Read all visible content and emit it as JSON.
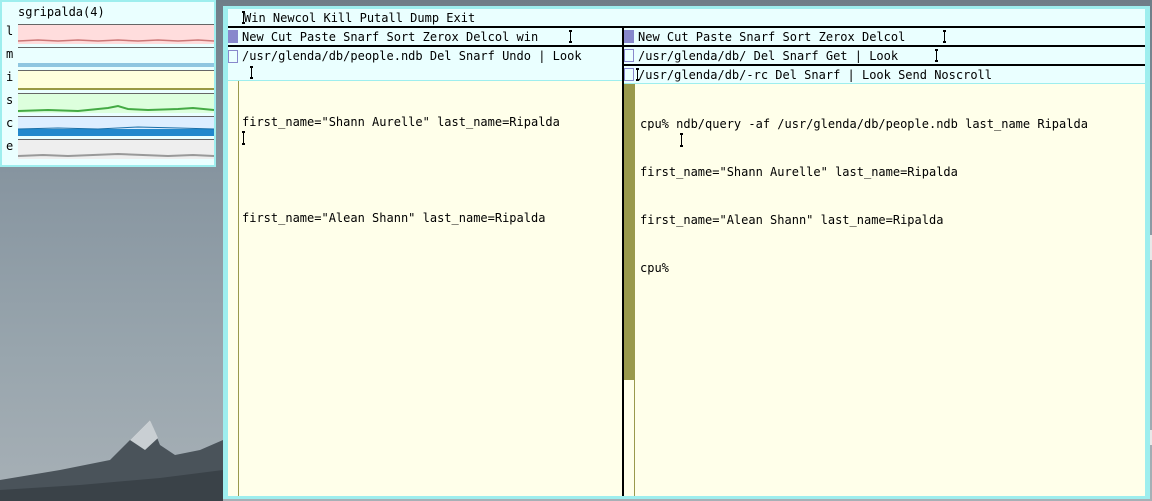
{
  "stats": {
    "title": "sgripalda(4)",
    "rows": [
      {
        "label": "l",
        "bg": "#ffdddd",
        "line": "#cc7777"
      },
      {
        "label": "m",
        "bg": "#eaffff",
        "line": "#6fa8c8"
      },
      {
        "label": "i",
        "bg": "#ffffdd",
        "line": "#999944"
      },
      {
        "label": "s",
        "bg": "#ddffdd",
        "line": "#44aa44"
      },
      {
        "label": "c",
        "bg": "#ddeeff",
        "line": "#2288cc"
      },
      {
        "label": "e",
        "bg": "#eeeeee",
        "line": "#999999"
      }
    ]
  },
  "acme": {
    "main_tag": "Win Newcol Kill Putall Dump Exit",
    "left_column": {
      "tag": "New Cut Paste Snarf Sort Zerox Delcol win",
      "window": {
        "tag": "/usr/glenda/db/people.ndb Del Snarf Undo | Look",
        "body": [
          "first_name=\"Shann Aurelle\" last_name=Ripalda",
          "",
          "first_name=\"Alean Shann\" last_name=Ripalda"
        ]
      }
    },
    "right_column": {
      "tag": "New Cut Paste Snarf Sort Zerox Delcol",
      "windows": [
        {
          "tag": "/usr/glenda/db/ Del Snarf Get | Look"
        },
        {
          "tag": "/usr/glenda/db/-rc Del Snarf | Look Send Noscroll",
          "body": [
            "cpu% ndb/query -af /usr/glenda/db/people.ndb last_name Ripalda",
            "first_name=\"Shann Aurelle\" last_name=Ripalda",
            "first_name=\"Alean Shann\" last_name=Ripalda",
            "cpu%"
          ]
        }
      ]
    }
  },
  "colors": {
    "tag_bg": "#eaffff",
    "body_bg": "#ffffea",
    "border": "#9eeeee",
    "button": "#8888cc",
    "scroll_thumb": "#99994c"
  }
}
